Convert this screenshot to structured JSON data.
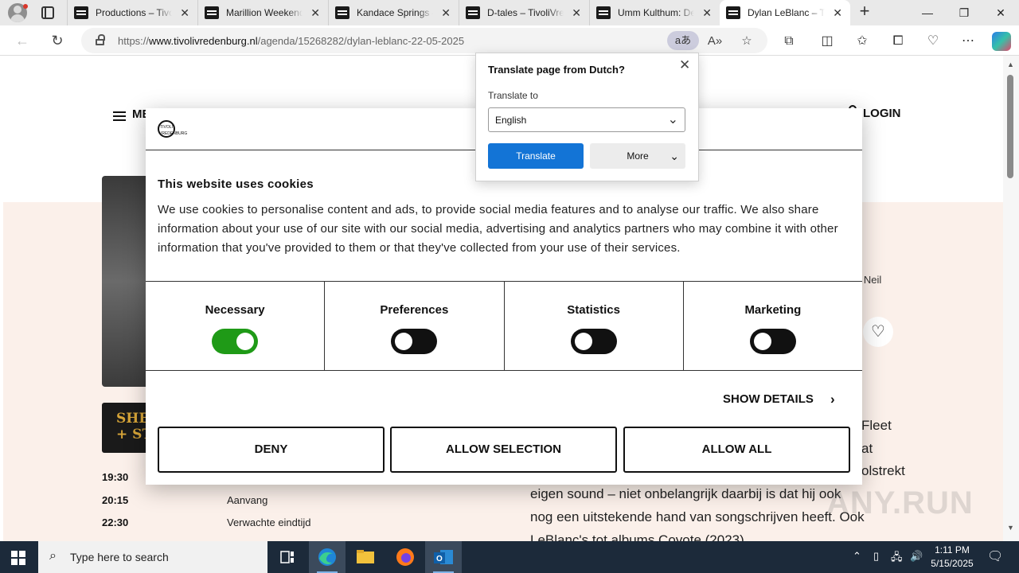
{
  "browser": {
    "tabs": [
      {
        "label": "Productions – Tivo",
        "active": false
      },
      {
        "label": "Marillion Weekend",
        "active": false
      },
      {
        "label": "Kandace Springs –",
        "active": false
      },
      {
        "label": "D-tales – TivoliVrec",
        "active": false
      },
      {
        "label": "Umm Kulthum: De",
        "active": false
      },
      {
        "label": "Dylan LeBlanc – Tiv",
        "active": true
      }
    ],
    "url_prefix": "https://",
    "url_host": "www.tivolivredenburg.nl",
    "url_path": "/agenda/15268282/dylan-leblanc-22-05-2025",
    "translate_glyph": "aあ"
  },
  "translate_popup": {
    "title": "Translate page from Dutch?",
    "label": "Translate to",
    "selected_language": "English",
    "translate_button": "Translate",
    "more_button": "More"
  },
  "site": {
    "menu_label": "ME",
    "login_label": "LOGIN",
    "side_text": "n Neil",
    "thumb_text": "SHE\n+ STO",
    "schedule": [
      {
        "time": "19:30",
        "label": ""
      },
      {
        "time": "20:15",
        "label": "Aanvang"
      },
      {
        "time": "22:30",
        "label": "Verwachte eindtijd"
      }
    ],
    "body_lines": [
      "eigen sound – niet onbelangrijk daarbij is dat hij ook",
      "nog een uitstekende hand van songschrijven heeft. Ook",
      "LeBlanc's tot albums Coyote (2023) ..."
    ],
    "right_fragments": [
      "c",
      "Fleet",
      "at",
      "olstrekt"
    ],
    "watermark": "ANY.RUN"
  },
  "cookie": {
    "title": "This website uses cookies",
    "text": "We use cookies to personalise content and ads, to provide social media features and to analyse our traffic. We also share information about your use of our site with our social media, advertising and analytics partners who may combine it with other information that you've provided to them or that they've collected from your use of their services.",
    "categories": [
      {
        "name": "Necessary",
        "on": true
      },
      {
        "name": "Preferences",
        "on": false
      },
      {
        "name": "Statistics",
        "on": false
      },
      {
        "name": "Marketing",
        "on": false
      }
    ],
    "show_details": "SHOW DETAILS",
    "buttons": {
      "deny": "DENY",
      "allow_selection": "ALLOW SELECTION",
      "allow_all": "ALLOW ALL"
    },
    "logo_text": "TIVOLI VREDENBURG"
  },
  "taskbar": {
    "search_placeholder": "Type here to search",
    "time": "1:11 PM",
    "date": "5/15/2025"
  },
  "colors": {
    "toggle_on": "#1f9a17",
    "toggle_off": "#111111",
    "translate_btn": "#1374d6",
    "page_peach": "#fbf0ea"
  }
}
